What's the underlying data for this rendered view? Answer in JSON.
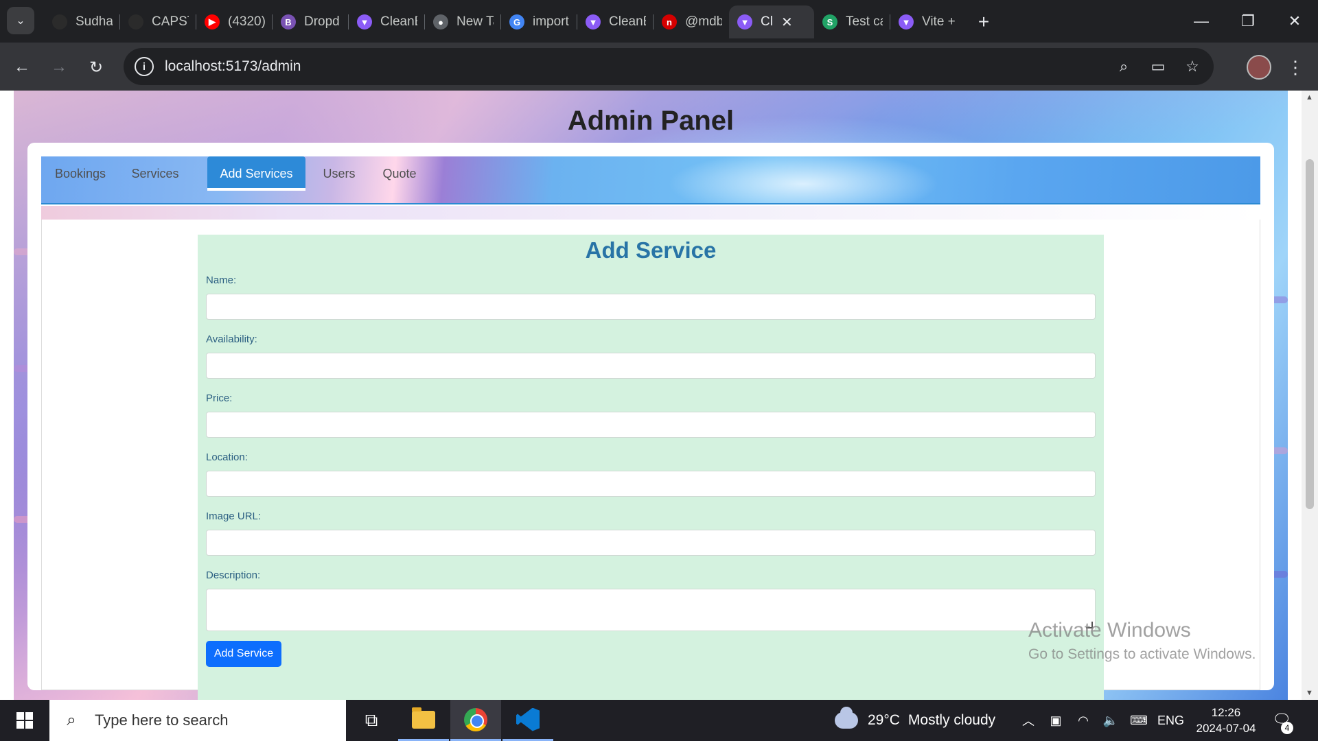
{
  "browser": {
    "tabs": [
      {
        "title": "Sudha",
        "fav_color": "#2b2b2b",
        "fav_icon": "github-icon",
        "glyph": ""
      },
      {
        "title": "CAPST",
        "fav_color": "#2b2b2b",
        "fav_icon": "github-icon",
        "glyph": ""
      },
      {
        "title": "(4320)",
        "fav_color": "#ff0000",
        "fav_icon": "youtube-icon",
        "glyph": "▶"
      },
      {
        "title": "Dropd",
        "fav_color": "#7952b3",
        "fav_icon": "bootstrap-icon",
        "glyph": "B"
      },
      {
        "title": "CleanE",
        "fav_color": "#8b5cf6",
        "fav_icon": "vite-icon",
        "glyph": "▼"
      },
      {
        "title": "New Ta",
        "fav_color": "#5f6368",
        "fav_icon": "chrome-icon",
        "glyph": "●"
      },
      {
        "title": "import",
        "fav_color": "#4285f4",
        "fav_icon": "google-icon",
        "glyph": "G"
      },
      {
        "title": "CleanE",
        "fav_color": "#8b5cf6",
        "fav_icon": "vite-icon",
        "glyph": "▼"
      },
      {
        "title": "@mdb",
        "fav_color": "#d50000",
        "fav_icon": "mdb-icon",
        "glyph": "n"
      },
      {
        "title": "Cl",
        "fav_color": "#8b5cf6",
        "fav_icon": "vite-icon",
        "glyph": "▼",
        "active": true
      },
      {
        "title": "Test ca",
        "fav_color": "#21a366",
        "fav_icon": "sheets-icon",
        "glyph": "S"
      },
      {
        "title": "Vite +",
        "fav_color": "#8b5cf6",
        "fav_icon": "vite-icon",
        "glyph": "▼"
      }
    ],
    "url": "localhost:5173/admin",
    "icons": {
      "back": "←",
      "forward": "→",
      "reload": "↻",
      "site_info": "i",
      "zoom": "⌕",
      "card": "▭",
      "bookmark": "☆",
      "menu": "⋮",
      "new_tab": "+",
      "tab_search": "⌄",
      "close_tab": "✕",
      "minimize": "—",
      "restore": "❐",
      "close_window": "✕"
    }
  },
  "page": {
    "title": "Admin Panel",
    "tabs": [
      "Bookings",
      "Services",
      "Add Services",
      "Users",
      "Quote"
    ],
    "active_tab": "Add Services",
    "form": {
      "heading": "Add Service",
      "fields": {
        "name": {
          "label": "Name:",
          "value": ""
        },
        "availability": {
          "label": "Availability:",
          "value": ""
        },
        "price": {
          "label": "Price:",
          "value": ""
        },
        "location": {
          "label": "Location:",
          "value": ""
        },
        "image_url": {
          "label": "Image URL:",
          "value": ""
        },
        "description": {
          "label": "Description:",
          "value": ""
        }
      },
      "submit_label": "Add Service"
    },
    "watermark": {
      "line1": "Activate Windows",
      "line2": "Go to Settings to activate Windows."
    }
  },
  "taskbar": {
    "search_placeholder": "Type here to search",
    "weather": {
      "temp": "29°C",
      "condition": "Mostly cloudy"
    },
    "language": "ENG",
    "time": "12:26",
    "date": "2024-07-04",
    "notification_count": "4",
    "icons": {
      "search": "⌕",
      "task_view": "⧉",
      "tray_up": "︿",
      "battery": "▣",
      "wifi": "◠",
      "volume": "🔈",
      "keyboard": "⌨",
      "notifications": "🗨"
    }
  }
}
